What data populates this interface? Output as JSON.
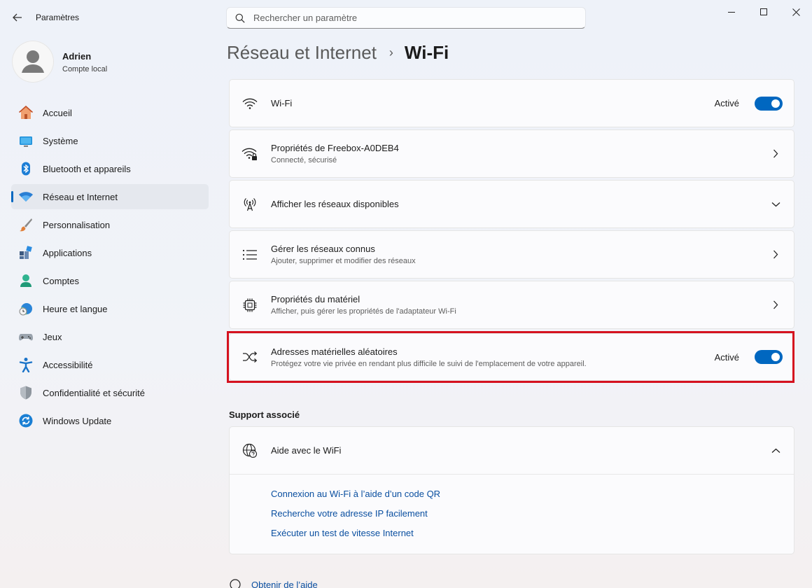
{
  "app": {
    "title": "Paramètres"
  },
  "search": {
    "placeholder": "Rechercher un paramètre"
  },
  "user": {
    "name": "Adrien",
    "account_type": "Compte local"
  },
  "sidebar": {
    "items": [
      {
        "label": "Accueil",
        "icon": "home-icon",
        "active": false
      },
      {
        "label": "Système",
        "icon": "system-icon",
        "active": false
      },
      {
        "label": "Bluetooth et appareils",
        "icon": "bluetooth-icon",
        "active": false
      },
      {
        "label": "Réseau et Internet",
        "icon": "wifi-icon",
        "active": true
      },
      {
        "label": "Personnalisation",
        "icon": "brush-icon",
        "active": false
      },
      {
        "label": "Applications",
        "icon": "apps-icon",
        "active": false
      },
      {
        "label": "Comptes",
        "icon": "accounts-icon",
        "active": false
      },
      {
        "label": "Heure et langue",
        "icon": "clock-globe-icon",
        "active": false
      },
      {
        "label": "Jeux",
        "icon": "gamepad-icon",
        "active": false
      },
      {
        "label": "Accessibilité",
        "icon": "accessibility-icon",
        "active": false
      },
      {
        "label": "Confidentialité et sécurité",
        "icon": "shield-icon",
        "active": false
      },
      {
        "label": "Windows Update",
        "icon": "update-icon",
        "active": false
      }
    ]
  },
  "header": {
    "parent": "Réseau et Internet",
    "separator": "›",
    "current": "Wi-Fi"
  },
  "settings": {
    "wifi": {
      "title": "Wi-Fi",
      "state": "Activé"
    },
    "network_props": {
      "title": "Propriétés de Freebox-A0DEB4",
      "subtitle": "Connecté, sécurisé"
    },
    "available": {
      "title": "Afficher les réseaux disponibles"
    },
    "known": {
      "title": "Gérer les réseaux connus",
      "subtitle": "Ajouter, supprimer et modifier des réseaux"
    },
    "hardware": {
      "title": "Propriétés du matériel",
      "subtitle": "Afficher, puis gérer les propriétés de l'adaptateur Wi-Fi"
    },
    "random_mac": {
      "title": "Adresses matérielles aléatoires",
      "subtitle": "Protégez votre vie privée en rendant plus difficile le suivi de l'emplacement de votre appareil.",
      "state": "Activé"
    }
  },
  "support": {
    "section_title": "Support associé",
    "help_title": "Aide avec le WiFi",
    "links": [
      "Connexion au Wi-Fi à l’aide d’un code QR",
      "Recherche votre adresse IP facilement",
      "Exécuter un test de vitesse Internet"
    ]
  },
  "footer": {
    "get_help": "Obtenir de l’aide"
  },
  "colors": {
    "accent": "#0067c0",
    "highlight": "#d5121f",
    "link": "#0a4fa0"
  }
}
